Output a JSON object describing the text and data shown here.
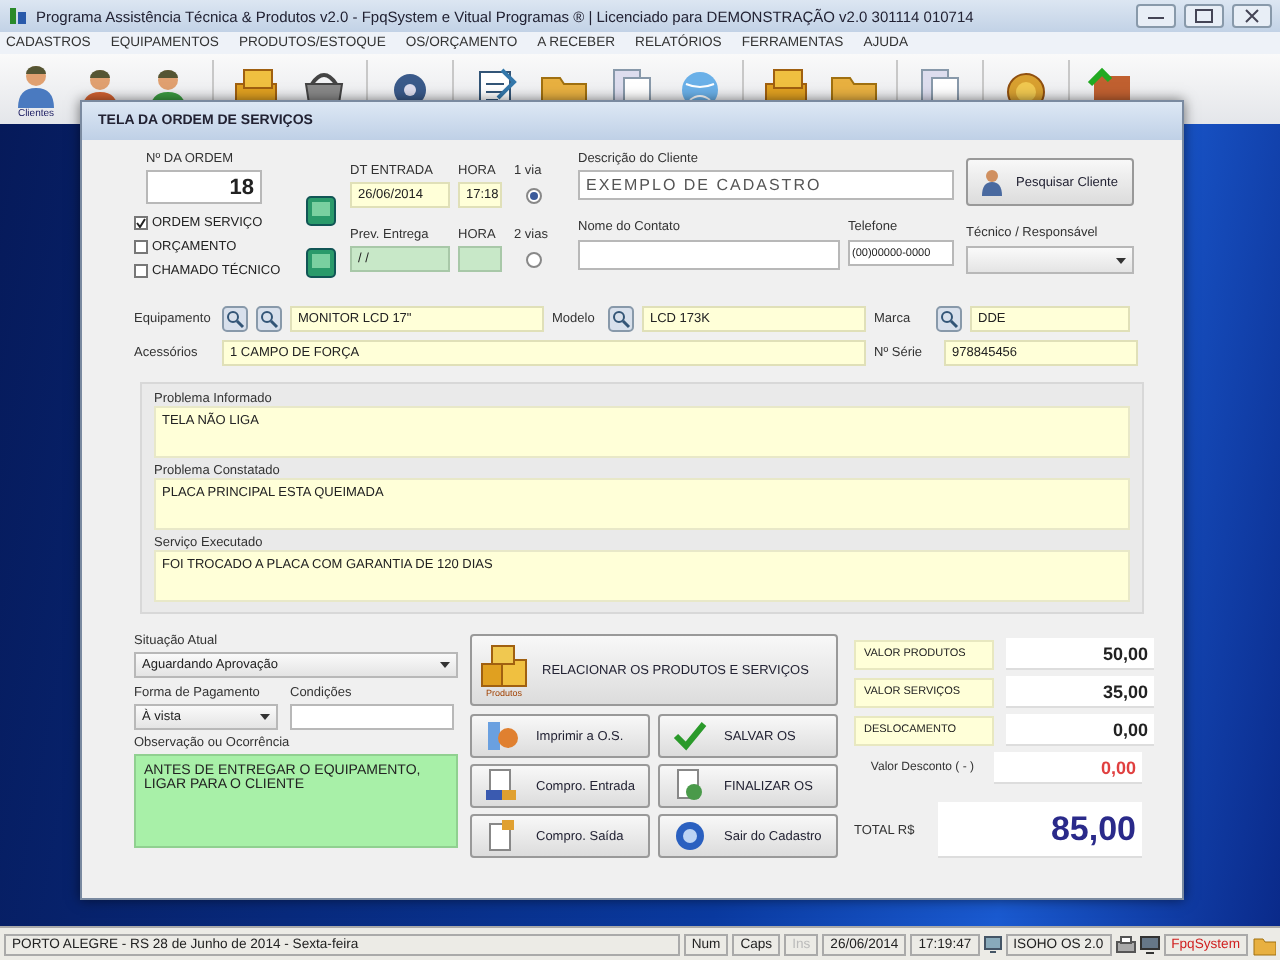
{
  "window": {
    "title": "Programa Assistência Técnica & Produtos v2.0 - FpqSystem e Vitual Programas ® | Licenciado para DEMONSTRAÇÃO v2.0 301114 010714"
  },
  "menu": [
    "CADASTROS",
    "EQUIPAMENTOS",
    "PRODUTOS/ESTOQUE",
    "OS/ORÇAMENTO",
    "A RECEBER",
    "RELATÓRIOS",
    "FERRAMENTAS",
    "AJUDA"
  ],
  "toolbar": {
    "clients_label": "Clientes"
  },
  "dialog": {
    "title": "TELA DA ORDEM DE SERVIÇOS",
    "order": {
      "label": "Nº DA ORDEM",
      "value": "18"
    },
    "order_types": [
      {
        "label": "ORDEM SERVIÇO",
        "checked": true
      },
      {
        "label": "ORÇAMENTO",
        "checked": false
      },
      {
        "label": "CHAMADO TÉCNICO",
        "checked": false
      }
    ],
    "entry": {
      "date_label": "DT ENTRADA",
      "date": "26/06/2014",
      "time_label": "HORA",
      "time": "17:18"
    },
    "delivery": {
      "date_label": "Prev. Entrega",
      "date": "/ /",
      "time_label": "HORA"
    },
    "copies": [
      {
        "label": "1 via",
        "selected": true
      },
      {
        "label": "2 vias",
        "selected": false
      }
    ],
    "client": {
      "label": "Descrição do Cliente",
      "value": "EXEMPLO DE CADASTRO"
    },
    "search_client_button": "Pesquisar Cliente",
    "contact": {
      "label": "Nome do Contato"
    },
    "phone": {
      "label": "Telefone",
      "value": "(00)00000-0000"
    },
    "technician": {
      "label": "Técnico / Responsável"
    },
    "equipment": {
      "label": "Equipamento",
      "value": "MONITOR LCD 17\""
    },
    "model": {
      "label": "Modelo",
      "value": "LCD 173K"
    },
    "brand": {
      "label": "Marca",
      "value": "DDE"
    },
    "accessories": {
      "label": "Acessórios",
      "value": "1 CAMPO DE FORÇA"
    },
    "serial": {
      "label": "Nº Série",
      "value": "978845456"
    },
    "notes": [
      {
        "label": "Problema Informado",
        "value": "TELA NÃO LIGA"
      },
      {
        "label": "Problema Constatado",
        "value": "PLACA PRINCIPAL ESTA QUEIMADA"
      },
      {
        "label": "Serviço Executado",
        "value": "FOI TROCADO A PLACA COM GARANTIA DE 120 DIAS"
      }
    ],
    "status": {
      "label": "Situação Atual",
      "value": "Aguardando Aprovação"
    },
    "payment": {
      "label": "Forma de Pagamento",
      "value": "À vista"
    },
    "conditions": {
      "label": "Condições"
    },
    "observation": {
      "label": "Observação ou Ocorrência",
      "value": "ANTES DE ENTREGAR O EQUIPAMENTO, LIGAR PARA O CLIENTE"
    },
    "products_button": {
      "icon_label": "Produtos",
      "label": "RELACIONAR OS PRODUTOS E SERVIÇOS"
    },
    "actions": [
      {
        "label": "Imprimir a O.S.",
        "kind": "print"
      },
      {
        "label": "SALVAR OS",
        "kind": "save"
      },
      {
        "label": "Compro. Entrada",
        "kind": "entry"
      },
      {
        "label": "FINALIZAR OS",
        "kind": "finish"
      },
      {
        "label": "Compro. Saída",
        "kind": "exit"
      },
      {
        "label": "Sair do Cadastro",
        "kind": "close"
      }
    ],
    "totals": [
      {
        "label": "VALOR PRODUTOS",
        "value": "50,00",
        "kind": "boxed"
      },
      {
        "label": "VALOR SERVIÇOS",
        "value": "35,00",
        "kind": "boxed"
      },
      {
        "label": "DESLOCAMENTO",
        "value": "0,00",
        "kind": "boxed"
      },
      {
        "label": "Valor Desconto ( - )",
        "value": "0,00",
        "kind": "discount"
      }
    ],
    "total": {
      "label": "TOTAL R$",
      "value": "85,00"
    }
  },
  "status_bar": {
    "location": "PORTO ALEGRE - RS 28 de Junho de 2014 - Sexta-feira",
    "keys": [
      {
        "label": "Num",
        "disabled": false
      },
      {
        "label": "Caps",
        "disabled": false
      },
      {
        "label": "Ins",
        "disabled": true
      }
    ],
    "date": "26/06/2014",
    "time": "17:19:47",
    "version": "ISOHO OS 2.0",
    "brand": "FpqSystem"
  }
}
